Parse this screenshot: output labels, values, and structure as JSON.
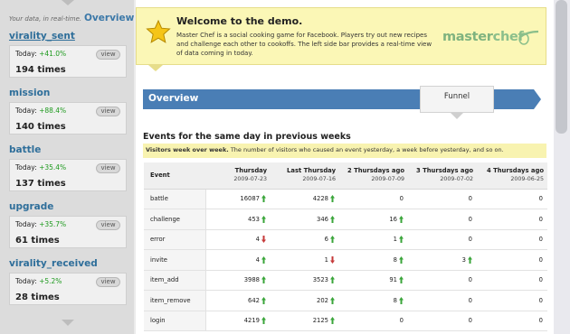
{
  "sidebar": {
    "tagline": "Your data, in real-time.",
    "title": "Overview",
    "metrics": [
      {
        "name": "virality_sent",
        "today_label": "Today:",
        "change": "+41.0%",
        "count": "194 times",
        "view_label": "view"
      },
      {
        "name": "mission",
        "today_label": "Today:",
        "change": "+88.4%",
        "count": "140 times",
        "view_label": "view"
      },
      {
        "name": "battle",
        "today_label": "Today:",
        "change": "+35.4%",
        "count": "137 times",
        "view_label": "view"
      },
      {
        "name": "upgrade",
        "today_label": "Today:",
        "change": "+35.7%",
        "count": "61 times",
        "view_label": "view"
      },
      {
        "name": "virality_received",
        "today_label": "Today:",
        "change": "+5.2%",
        "count": "28 times",
        "view_label": "view"
      }
    ]
  },
  "welcome": {
    "title": "Welcome to the demo.",
    "text": "Master Chef is a social cooking game for Facebook. Players try out new recipes and challenge each other to cookoffs. The left side bar provides a real-time view of data coming in today.",
    "logo_text_a": "master",
    "logo_text_b": "chef"
  },
  "overview": {
    "label": "Overview",
    "funnel_label": "Funnel"
  },
  "section": {
    "title": "Events for the same day in previous weeks",
    "notice_bold": "Visitors week over week.",
    "notice_text": " The number of visitors who caused an event yesterday, a week before yesterday, and so on."
  },
  "table": {
    "event_header": "Event",
    "columns": [
      {
        "label": "Thursday",
        "date": "2009-07-23"
      },
      {
        "label": "Last Thursday",
        "date": "2009-07-16"
      },
      {
        "label": "2 Thursdays ago",
        "date": "2009-07-09"
      },
      {
        "label": "3 Thursdays ago",
        "date": "2009-07-02"
      },
      {
        "label": "4 Thursdays ago",
        "date": "2009-06-25"
      }
    ],
    "rows": [
      {
        "event": "battle",
        "cells": [
          {
            "v": "16087",
            "t": "up"
          },
          {
            "v": "4228",
            "t": "up"
          },
          {
            "v": "0",
            "t": ""
          },
          {
            "v": "0",
            "t": ""
          },
          {
            "v": "0",
            "t": ""
          }
        ]
      },
      {
        "event": "challenge",
        "cells": [
          {
            "v": "453",
            "t": "up"
          },
          {
            "v": "346",
            "t": "up"
          },
          {
            "v": "16",
            "t": "up"
          },
          {
            "v": "0",
            "t": ""
          },
          {
            "v": "0",
            "t": ""
          }
        ]
      },
      {
        "event": "error",
        "cells": [
          {
            "v": "4",
            "t": "down"
          },
          {
            "v": "6",
            "t": "up"
          },
          {
            "v": "1",
            "t": "up"
          },
          {
            "v": "0",
            "t": ""
          },
          {
            "v": "0",
            "t": ""
          }
        ]
      },
      {
        "event": "invite",
        "cells": [
          {
            "v": "4",
            "t": "up"
          },
          {
            "v": "1",
            "t": "down"
          },
          {
            "v": "8",
            "t": "up"
          },
          {
            "v": "3",
            "t": "up"
          },
          {
            "v": "0",
            "t": ""
          }
        ]
      },
      {
        "event": "item_add",
        "cells": [
          {
            "v": "3988",
            "t": "up"
          },
          {
            "v": "3523",
            "t": "up"
          },
          {
            "v": "91",
            "t": "up"
          },
          {
            "v": "0",
            "t": ""
          },
          {
            "v": "0",
            "t": ""
          }
        ]
      },
      {
        "event": "item_remove",
        "cells": [
          {
            "v": "642",
            "t": "up"
          },
          {
            "v": "202",
            "t": "up"
          },
          {
            "v": "8",
            "t": "up"
          },
          {
            "v": "0",
            "t": ""
          },
          {
            "v": "0",
            "t": ""
          }
        ]
      },
      {
        "event": "login",
        "cells": [
          {
            "v": "4219",
            "t": "up"
          },
          {
            "v": "2125",
            "t": "up"
          },
          {
            "v": "0",
            "t": ""
          },
          {
            "v": "0",
            "t": ""
          },
          {
            "v": "0",
            "t": ""
          }
        ]
      }
    ]
  },
  "colors": {
    "up": "#3aa53a",
    "down": "#c63a3a",
    "accent": "#4a7eb5"
  },
  "icons": {
    "welcome": "star-icon",
    "up": "arrow-up-icon",
    "down": "arrow-down-icon"
  }
}
